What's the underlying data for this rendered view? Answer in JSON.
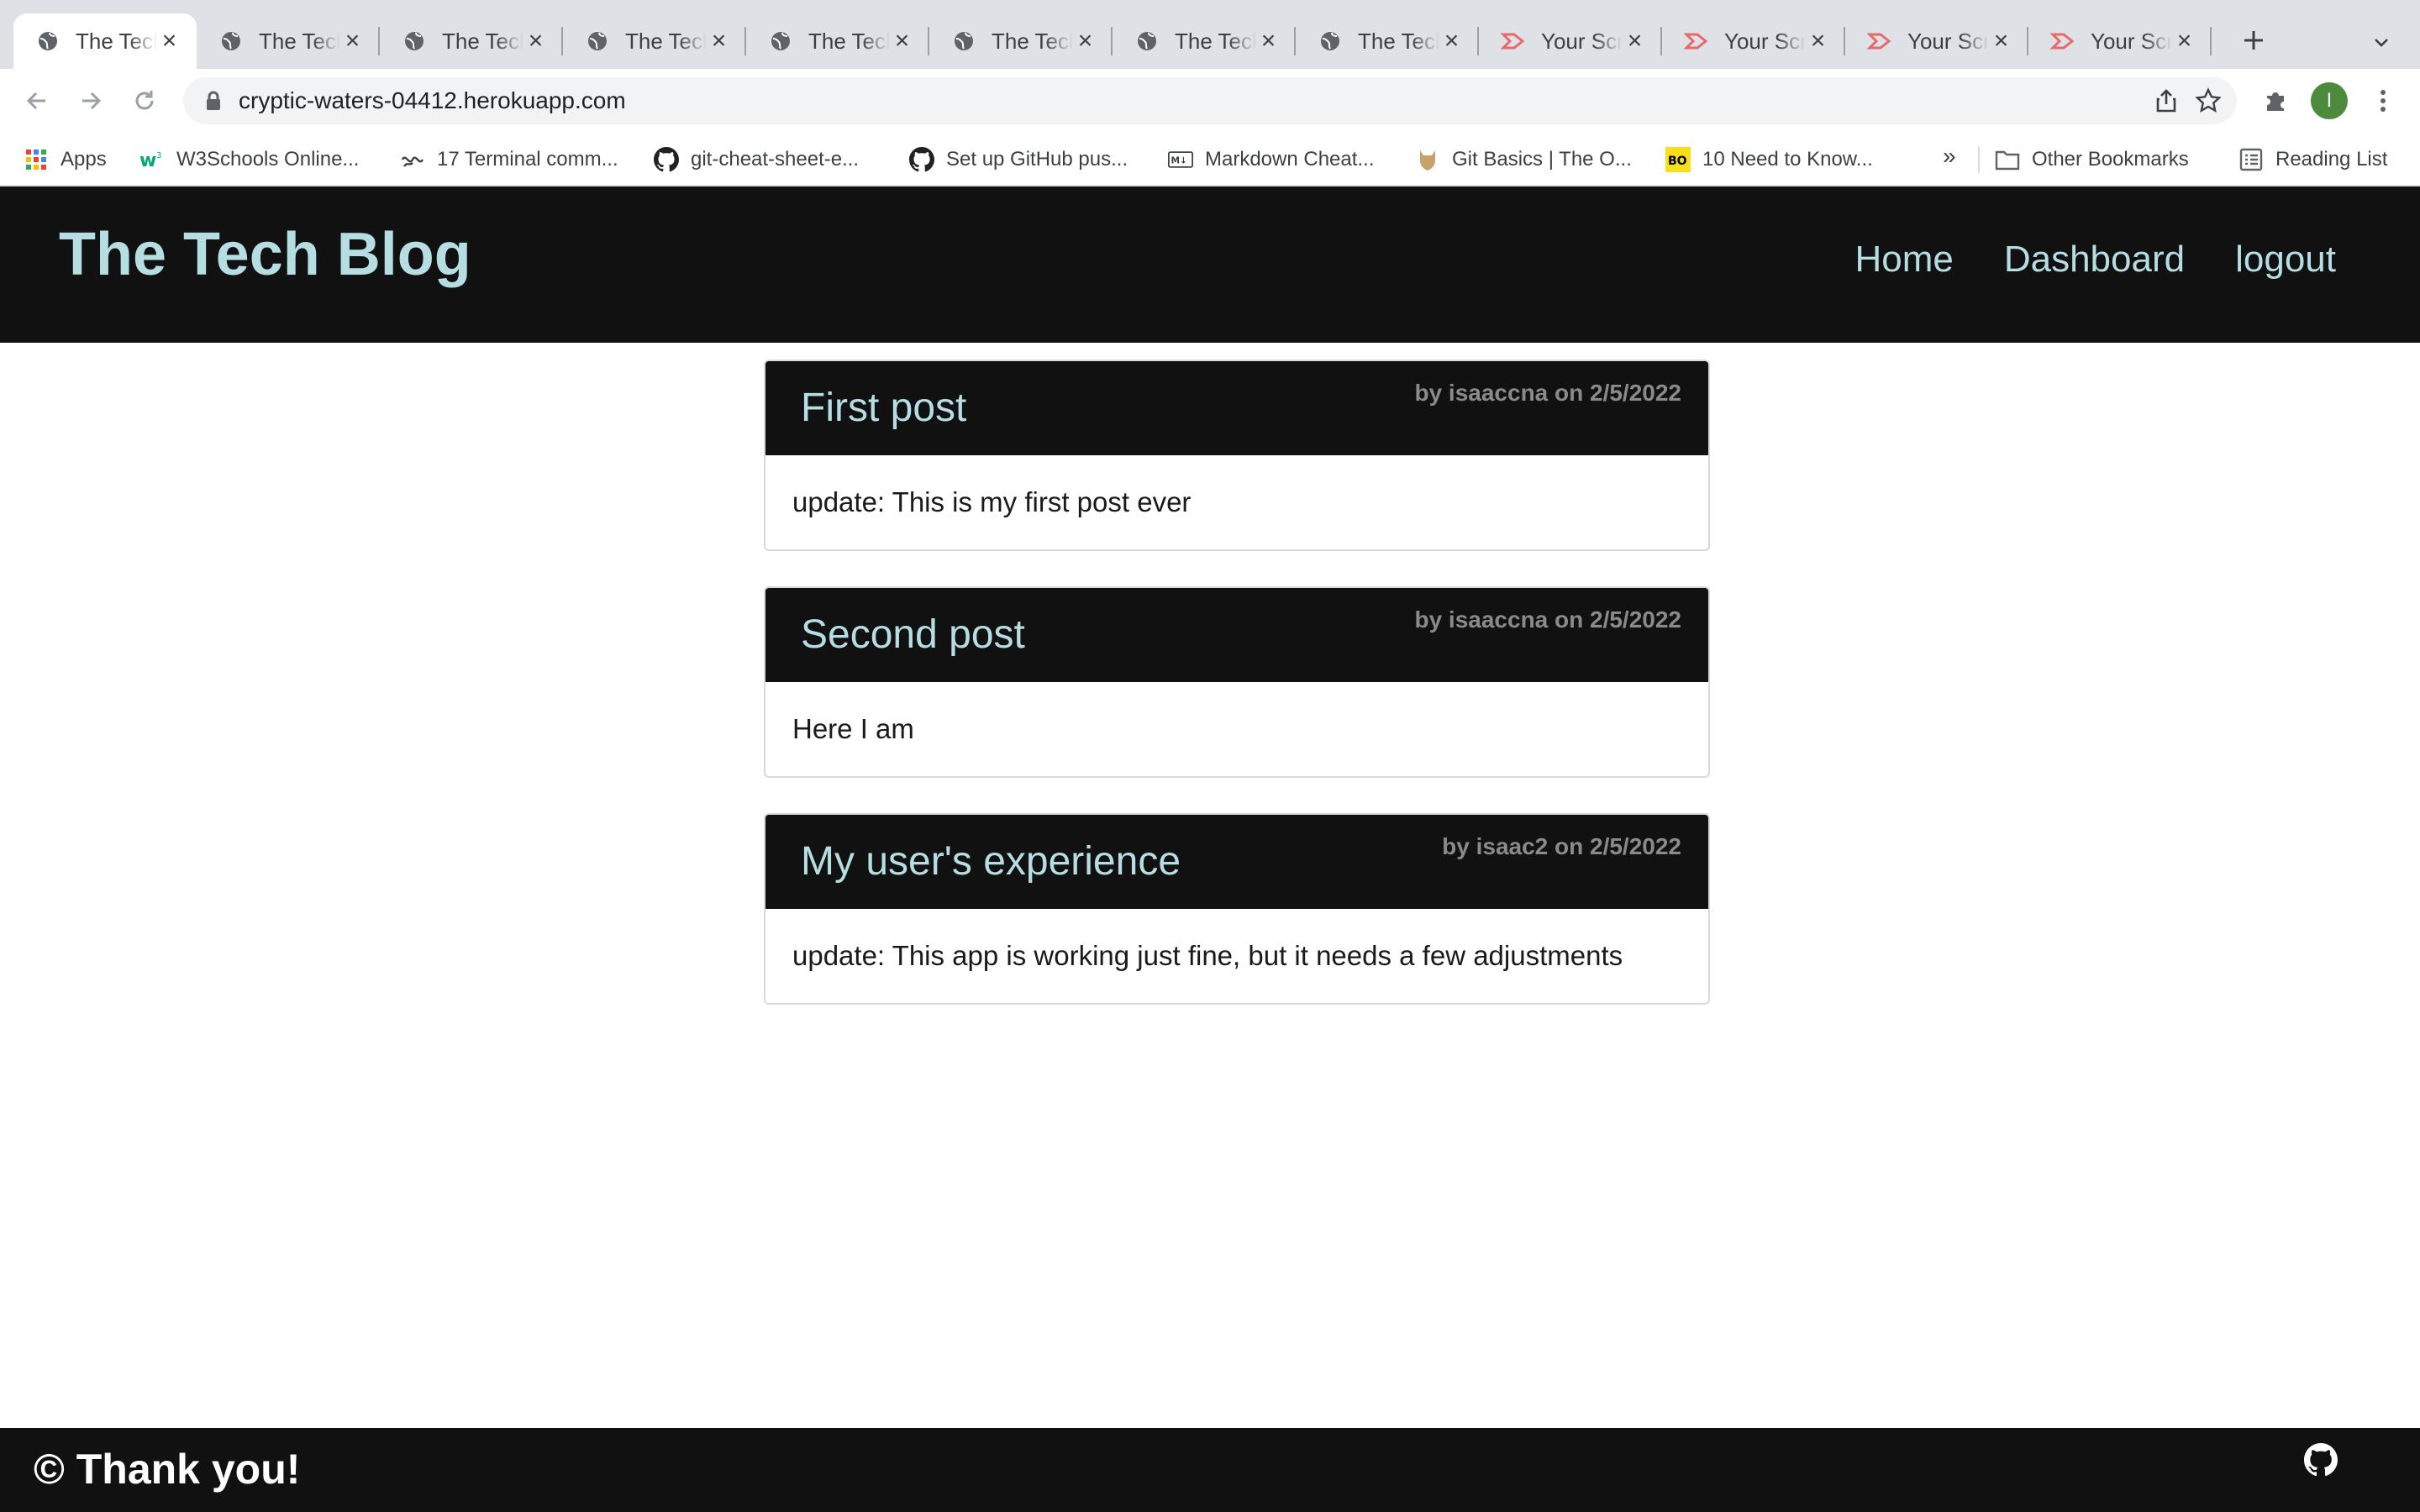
{
  "browser": {
    "tabs": [
      {
        "title": "The Tech Blog",
        "favicon": "globe-icon",
        "active": true
      },
      {
        "title": "The Tech Blog",
        "favicon": "globe-icon",
        "active": false
      },
      {
        "title": "The Tech Blog",
        "favicon": "globe-icon",
        "active": false
      },
      {
        "title": "The Tech Blog",
        "favicon": "globe-icon",
        "active": false
      },
      {
        "title": "The Tech Blog",
        "favicon": "globe-icon",
        "active": false
      },
      {
        "title": "The Tech Blog",
        "favicon": "globe-icon",
        "active": false
      },
      {
        "title": "The Tech Blog",
        "favicon": "globe-icon",
        "active": false
      },
      {
        "title": "The Tech Blog",
        "favicon": "globe-icon",
        "active": false
      },
      {
        "title": "Your Screencastify",
        "favicon": "screencastify-icon",
        "active": false
      },
      {
        "title": "Your Screencastify",
        "favicon": "screencastify-icon",
        "active": false
      },
      {
        "title": "Your Screencastify",
        "favicon": "screencastify-icon",
        "active": false
      },
      {
        "title": "Your Screencastify",
        "favicon": "screencastify-icon",
        "active": false
      }
    ],
    "url": "cryptic-waters-04412.herokuapp.com",
    "profile_initial": "I",
    "bookmarks": [
      {
        "label": "Apps",
        "icon": "apps-grid-icon"
      },
      {
        "label": "W3Schools Online...",
        "icon": "w3schools-icon"
      },
      {
        "label": "17 Terminal comm...",
        "icon": "terminal-icon"
      },
      {
        "label": "git-cheat-sheet-e...",
        "icon": "github-icon"
      },
      {
        "label": "Set up GitHub pus...",
        "icon": "github-icon"
      },
      {
        "label": "Markdown Cheat...",
        "icon": "markdown-icon"
      },
      {
        "label": "Git Basics | The O...",
        "icon": "odin-icon"
      },
      {
        "label": "10 Need to Know...",
        "icon": "bo-icon"
      }
    ],
    "bookmarks_more": "»",
    "other_bookmarks": "Other Bookmarks",
    "reading_list": "Reading List",
    "colors": {
      "tabstrip": "#dee1e6",
      "omnibox": "#f1f3f4",
      "avatar": "#4c8a3c"
    }
  },
  "site": {
    "title": "The Tech Blog",
    "nav": {
      "home": "Home",
      "dashboard": "Dashboard",
      "logout": "logout"
    },
    "colors": {
      "header_bg": "#111111",
      "accent": "#b5dde2",
      "meta": "#8a8a8a"
    }
  },
  "posts": [
    {
      "title": "First post",
      "meta": "by isaaccna on 2/5/2022",
      "body": "update: This is my first post ever"
    },
    {
      "title": "Second post",
      "meta": "by isaaccna on 2/5/2022",
      "body": "Here I am"
    },
    {
      "title": "My user's experience",
      "meta": "by isaac2 on 2/5/2022",
      "body": "update: This app is working just fine, but it needs a few adjustments"
    }
  ],
  "footer": {
    "text": "© Thank you!",
    "icon": "github-icon"
  }
}
